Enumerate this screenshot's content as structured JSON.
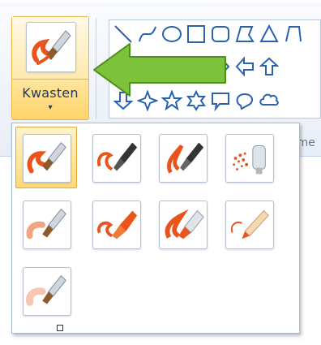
{
  "ribbon": {
    "brushes": {
      "label": "Kwasten",
      "caret": "▾",
      "icon": "brush-icon"
    },
    "shapes_group_label": "Vorme"
  },
  "colors": {
    "accent_orange": "#e8541c",
    "highlight_gold": "#ffd46a",
    "arrow_green": "#7cc23a",
    "label_blue": "#1e395b",
    "shape_blue": "#2a62b0"
  },
  "shapes": [
    "line-icon",
    "curve-icon",
    "oval-icon",
    "rectangle-icon",
    "rounded-rectangle-icon",
    "polygon-icon",
    "triangle-icon",
    "right-triangle-icon",
    "diamond-icon",
    "pentagon-icon",
    "hexagon-icon",
    "arrow-right-icon",
    "arrow-left-icon",
    "arrow-up-icon",
    "arrow-down-icon",
    "star4-icon",
    "star5-icon",
    "star6-icon",
    "callout-rect-icon",
    "callout-oval-icon",
    "callout-cloud-icon"
  ],
  "brush_types": [
    {
      "icon": "brush-icon",
      "selected": true
    },
    {
      "icon": "calligraphy-brush-1-icon",
      "selected": false
    },
    {
      "icon": "calligraphy-brush-2-icon",
      "selected": false
    },
    {
      "icon": "airbrush-icon",
      "selected": false
    },
    {
      "icon": "oil-brush-icon",
      "selected": false
    },
    {
      "icon": "crayon-icon",
      "selected": false
    },
    {
      "icon": "marker-icon",
      "selected": false
    },
    {
      "icon": "natural-pencil-icon",
      "selected": false
    },
    {
      "icon": "watercolor-brush-icon",
      "selected": false
    }
  ]
}
